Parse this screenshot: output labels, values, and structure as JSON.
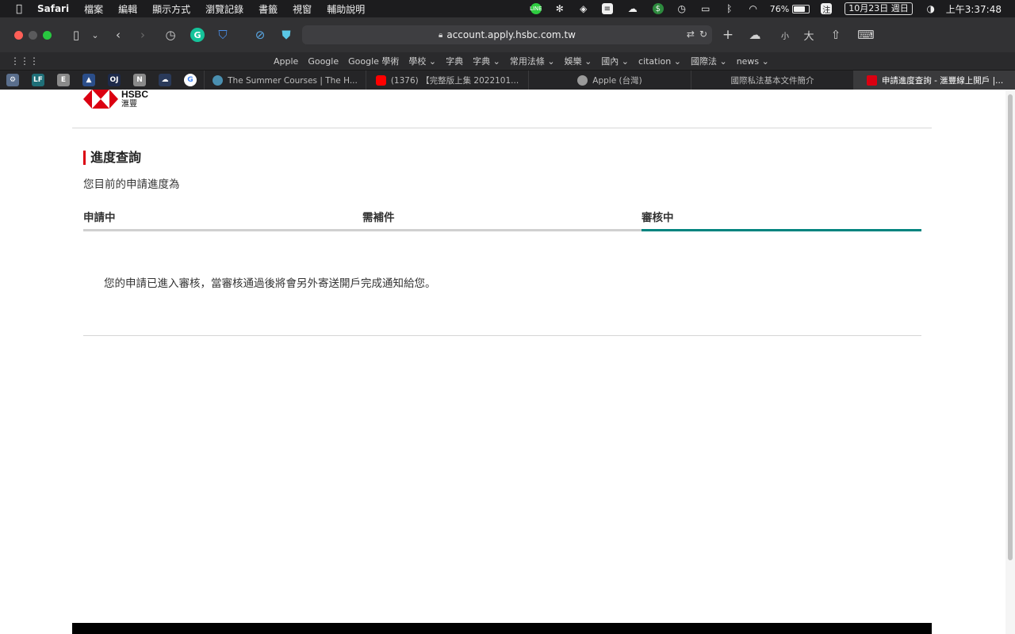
{
  "menubar": {
    "app_name": "Safari",
    "items": [
      "檔案",
      "編輯",
      "顯示方式",
      "瀏覽記錄",
      "書籤",
      "視窗",
      "輔助說明"
    ],
    "battery_percent": "76%",
    "battery_level": 0.76,
    "date": "10月23日 週日",
    "time": "上午3:37:48",
    "status_icons": [
      "line-icon",
      "aperture-icon",
      "dropbox-icon",
      "notes-icon",
      "cloud-icon",
      "dollar-icon",
      "time-machine-icon",
      "display-icon",
      "bluetooth-icon",
      "wifi-icon",
      "input-method-icon",
      "control-center-icon"
    ],
    "input_method": "注"
  },
  "toolbar": {
    "url": "account.apply.hsbc.com.tw",
    "text_small": "小",
    "text_large": "大"
  },
  "bookmarks": [
    "Apple",
    "Google",
    "Google 學術",
    "學校 ⌄",
    "字典",
    "字典 ⌄",
    "常用法條 ⌄",
    "娛樂 ⌄",
    "國內 ⌄",
    "citation ⌄",
    "國際法 ⌄",
    "news ⌄"
  ],
  "pinned_tabs": [
    {
      "icon": "gear-icon",
      "glyph": "⚙",
      "color": "#5a6e8c"
    },
    {
      "icon": "lf-icon",
      "glyph": "LF",
      "color": "#1f6f78"
    },
    {
      "icon": "e-icon",
      "glyph": "E",
      "color": "#8a8a8a"
    },
    {
      "icon": "triangle-icon",
      "glyph": "▲",
      "color": "#2b4e8a"
    },
    {
      "icon": "oj-icon",
      "glyph": "OJ",
      "color": "#1d2a4a"
    },
    {
      "icon": "notion-icon",
      "glyph": "N",
      "color": "#8a8a8a"
    },
    {
      "icon": "onedrive-icon",
      "glyph": "☁",
      "color": "#2a3a5a"
    },
    {
      "icon": "google-icon",
      "glyph": "G",
      "color": "#ffffff"
    }
  ],
  "tabs": [
    {
      "title": "The Summer Courses | The H...",
      "favicon_color": "#4a8fb0"
    },
    {
      "title": "(1376) 【完整版上集 2022101...",
      "favicon_color": "#ff0000"
    },
    {
      "title": "Apple (台灣)",
      "favicon_color": "#9a9a9a"
    },
    {
      "title": "國際私法基本文件簡介",
      "favicon_color": ""
    },
    {
      "title": "申請進度查詢 - 滙豐線上開戶 |...",
      "favicon_color": "#db0011"
    }
  ],
  "page": {
    "logo_en": "HSBC",
    "logo_zh": "滙豐",
    "section_title": "進度查詢",
    "subtitle": "您目前的申請進度為",
    "steps": [
      {
        "label": "申請中",
        "current": false
      },
      {
        "label": "需補件",
        "current": false
      },
      {
        "label": "審核中",
        "current": true
      }
    ],
    "status_message": "您的申請已進入審核，當審核通過後將會另外寄送開戶完成通知給您。",
    "accent_color": "#00847f",
    "brand_color": "#db0011"
  }
}
